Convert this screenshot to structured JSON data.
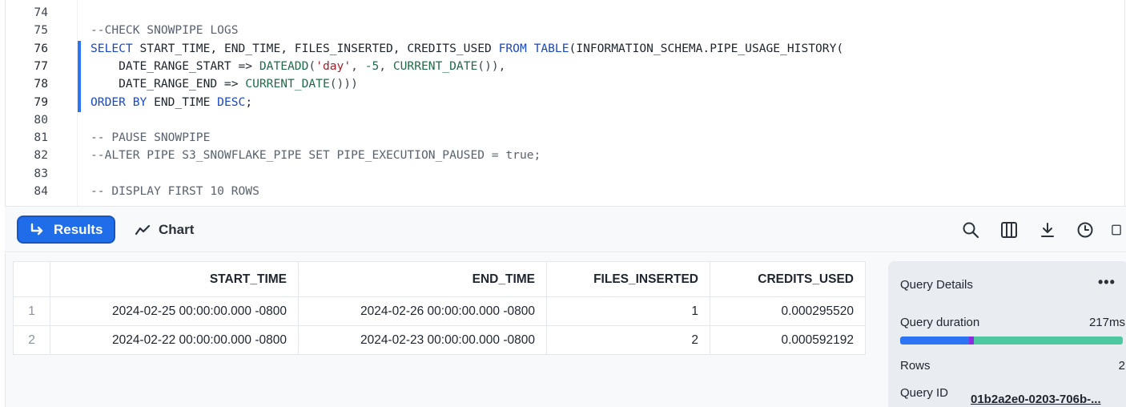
{
  "editor": {
    "lines": [
      {
        "n": "74",
        "tokens": []
      },
      {
        "n": "75",
        "tokens": [
          {
            "t": "--CHECK SNOWPIPE LOGS",
            "c": "cm"
          }
        ]
      },
      {
        "n": "76",
        "tokens": [
          {
            "t": "SELECT",
            "c": "kw"
          },
          {
            "t": " START_TIME, END_TIME, FILES_INSERTED, CREDITS_USED ",
            "c": "txt"
          },
          {
            "t": "FROM",
            "c": "kw"
          },
          {
            "t": " ",
            "c": "txt"
          },
          {
            "t": "TABLE",
            "c": "kw"
          },
          {
            "t": "(INFORMATION_SCHEMA.PIPE_USAGE_HISTORY(",
            "c": "txt"
          }
        ]
      },
      {
        "n": "77",
        "tokens": [
          {
            "t": "    DATE_RANGE_START => ",
            "c": "txt"
          },
          {
            "t": "DATEADD",
            "c": "fn"
          },
          {
            "t": "(",
            "c": "op"
          },
          {
            "t": "'day'",
            "c": "str"
          },
          {
            "t": ", ",
            "c": "op"
          },
          {
            "t": "-5",
            "c": "fn"
          },
          {
            "t": ", ",
            "c": "op"
          },
          {
            "t": "CURRENT_DATE",
            "c": "fn"
          },
          {
            "t": "()),",
            "c": "op"
          }
        ]
      },
      {
        "n": "78",
        "tokens": [
          {
            "t": "    DATE_RANGE_END => ",
            "c": "txt"
          },
          {
            "t": "CURRENT_DATE",
            "c": "fn"
          },
          {
            "t": "()))",
            "c": "op"
          }
        ]
      },
      {
        "n": "79",
        "tokens": [
          {
            "t": "ORDER BY",
            "c": "kw"
          },
          {
            "t": " END_TIME ",
            "c": "txt"
          },
          {
            "t": "DESC",
            "c": "kw"
          },
          {
            "t": ";",
            "c": "txt"
          }
        ]
      },
      {
        "n": "80",
        "tokens": []
      },
      {
        "n": "81",
        "tokens": [
          {
            "t": "-- PAUSE SNOWPIPE",
            "c": "cm"
          }
        ]
      },
      {
        "n": "82",
        "tokens": [
          {
            "t": "--ALTER PIPE S3_SNOWFLAKE_PIPE SET PIPE_EXECUTION_PAUSED = true;",
            "c": "cm"
          }
        ]
      },
      {
        "n": "83",
        "tokens": []
      },
      {
        "n": "84",
        "tokens": [
          {
            "t": "-- DISPLAY FIRST 10 ROWS",
            "c": "cm"
          }
        ]
      }
    ]
  },
  "toolbar": {
    "results_label": "Results",
    "chart_label": "Chart",
    "icons": [
      "search-icon",
      "columns-icon",
      "download-icon",
      "history-icon",
      "panel-icon"
    ]
  },
  "results": {
    "columns": [
      "START_TIME",
      "END_TIME",
      "FILES_INSERTED",
      "CREDITS_USED"
    ],
    "rows": [
      {
        "idx": "1",
        "cells": [
          "2024-02-25 00:00:00.000 -0800",
          "2024-02-26 00:00:00.000 -0800",
          "1",
          "0.000295520"
        ]
      },
      {
        "idx": "2",
        "cells": [
          "2024-02-22 00:00:00.000 -0800",
          "2024-02-23 00:00:00.000 -0800",
          "2",
          "0.000592192"
        ]
      }
    ]
  },
  "query_details": {
    "title": "Query Details",
    "duration_label": "Query duration",
    "duration_value": "217ms",
    "duration_breakdown": [
      0.31,
      0.02,
      0.67
    ],
    "rows_label": "Rows",
    "rows_value": "2",
    "query_id_label": "Query ID",
    "query_id_value": "01b2a2e0-0203-706b-..."
  },
  "colors": {
    "accent": "#1f6de8",
    "keyword": "#1a48c4",
    "function": "#1f6b4a",
    "string": "#a0202a",
    "comment": "#5a6270"
  }
}
